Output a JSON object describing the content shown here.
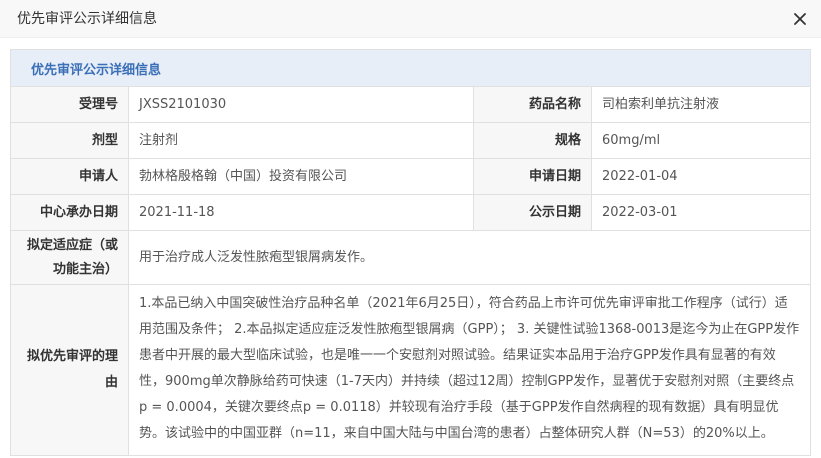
{
  "dialog": {
    "title": "优先审评公示详细信息",
    "close_icon": "close-icon"
  },
  "section_title": "优先审评公示详细信息",
  "fields": {
    "acceptance_no_label": "受理号",
    "acceptance_no": "JXSS2101030",
    "drug_name_label": "药品名称",
    "drug_name": "司柏索利单抗注射液",
    "dosage_form_label": "剂型",
    "dosage_form": "注射剂",
    "spec_label": "规格",
    "spec": "60mg/ml",
    "applicant_label": "申请人",
    "applicant": "勃林格殷格翰（中国）投资有限公司",
    "apply_date_label": "申请日期",
    "apply_date": "2022-01-04",
    "center_date_label": "中心承办日期",
    "center_date": "2021-11-18",
    "publish_date_label": "公示日期",
    "publish_date": "2022-03-01",
    "indication_label": "拟定适应症（或功能主治）",
    "indication": "用于治疗成人泛发性脓疱型银屑病发作。",
    "reason_label": "拟优先审评的理由",
    "reason": "1.本品已纳入中国突破性治疗品种名单（2021年6月25日），符合药品上市许可优先审评审批工作程序（试行）适用范围及条件； 2.本品拟定适应症泛发性脓疱型银屑病（GPP）； 3. 关键性试验1368-0013是迄今为止在GPP发作患者中开展的最大型临床试验，也是唯一一个安慰剂对照试验。结果证实本品用于治疗GPP发作具有显著的有效性，900mg单次静脉给药可快速（1-7天内）并持续（超过12周）控制GPP发作，显著优于安慰剂对照（主要终点p = 0.0004，关键次要终点p = 0.0118）并较现有治疗手段（基于GPP发作自然病程的现有数据）具有明显优势。该试验中的中国亚群（n=11，来自中国大陆与中国台湾的患者）占整体研究人群（N=53）的20%以上。"
  },
  "colors": {
    "header_bg": "#f8f8f8",
    "section_bg": "#e8eef7",
    "section_text": "#3a6fb8",
    "label_bg": "#f7f7f7",
    "border": "#e0e0e0"
  }
}
